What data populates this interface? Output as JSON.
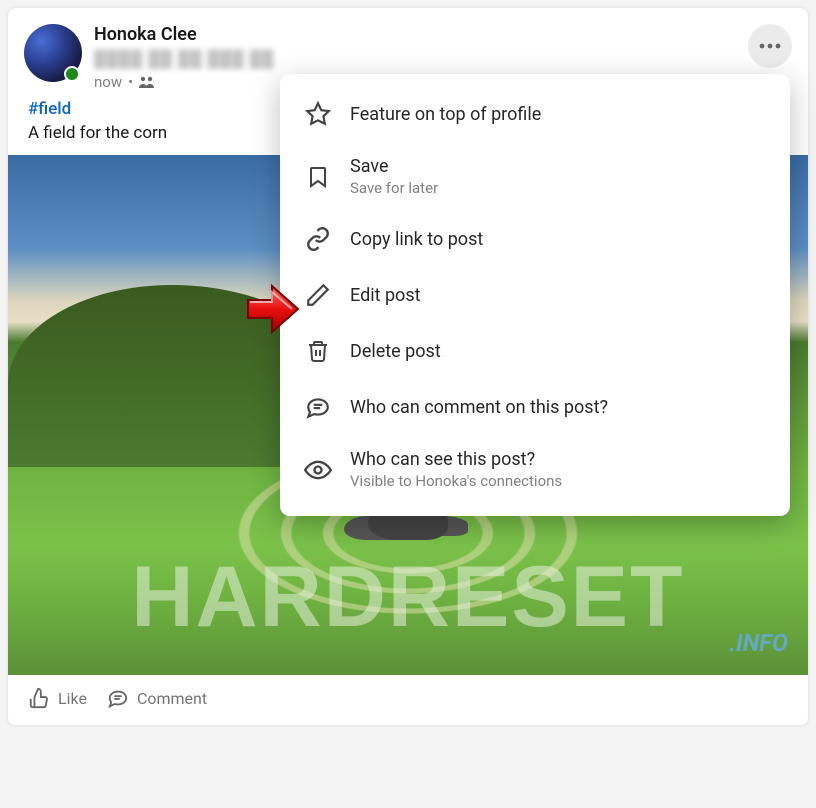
{
  "post": {
    "author": "Honoka Clee",
    "time": "now",
    "separator": "•",
    "hashtag": "#field",
    "text": "A field for the corn",
    "watermark": "HARDRESET",
    "watermark_small": ".INFO"
  },
  "actions": {
    "like": "Like",
    "comment": "Comment"
  },
  "menu": {
    "feature": {
      "label": "Feature on top of profile"
    },
    "save": {
      "label": "Save",
      "sub": "Save for later"
    },
    "copy": {
      "label": "Copy link to post"
    },
    "edit": {
      "label": "Edit post"
    },
    "delete": {
      "label": "Delete post"
    },
    "who_comment": {
      "label": "Who can comment on this post?"
    },
    "who_see": {
      "label": "Who can see this post?",
      "sub": "Visible to Honoka's connections"
    }
  }
}
